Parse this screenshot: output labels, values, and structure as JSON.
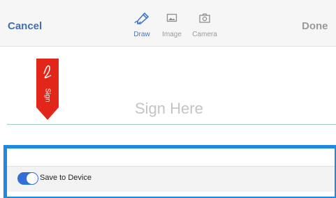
{
  "toolbar": {
    "cancel_label": "Cancel",
    "done_label": "Done",
    "tabs": [
      {
        "label": "Draw",
        "icon": "pen-icon",
        "active": true
      },
      {
        "label": "Image",
        "icon": "image-icon",
        "active": false
      },
      {
        "label": "Camera",
        "icon": "camera-icon",
        "active": false
      }
    ]
  },
  "signature": {
    "ribbon_label": "Sign",
    "placeholder": "Sign Here"
  },
  "save_toggle": {
    "label": "Save to Device",
    "enabled": true
  },
  "colors": {
    "accent": "#3f6fb0",
    "active_tab": "#3f77c8",
    "ribbon": "#e2261a",
    "highlight": "#1e88e5",
    "toggle_on": "#2f6fd6"
  }
}
